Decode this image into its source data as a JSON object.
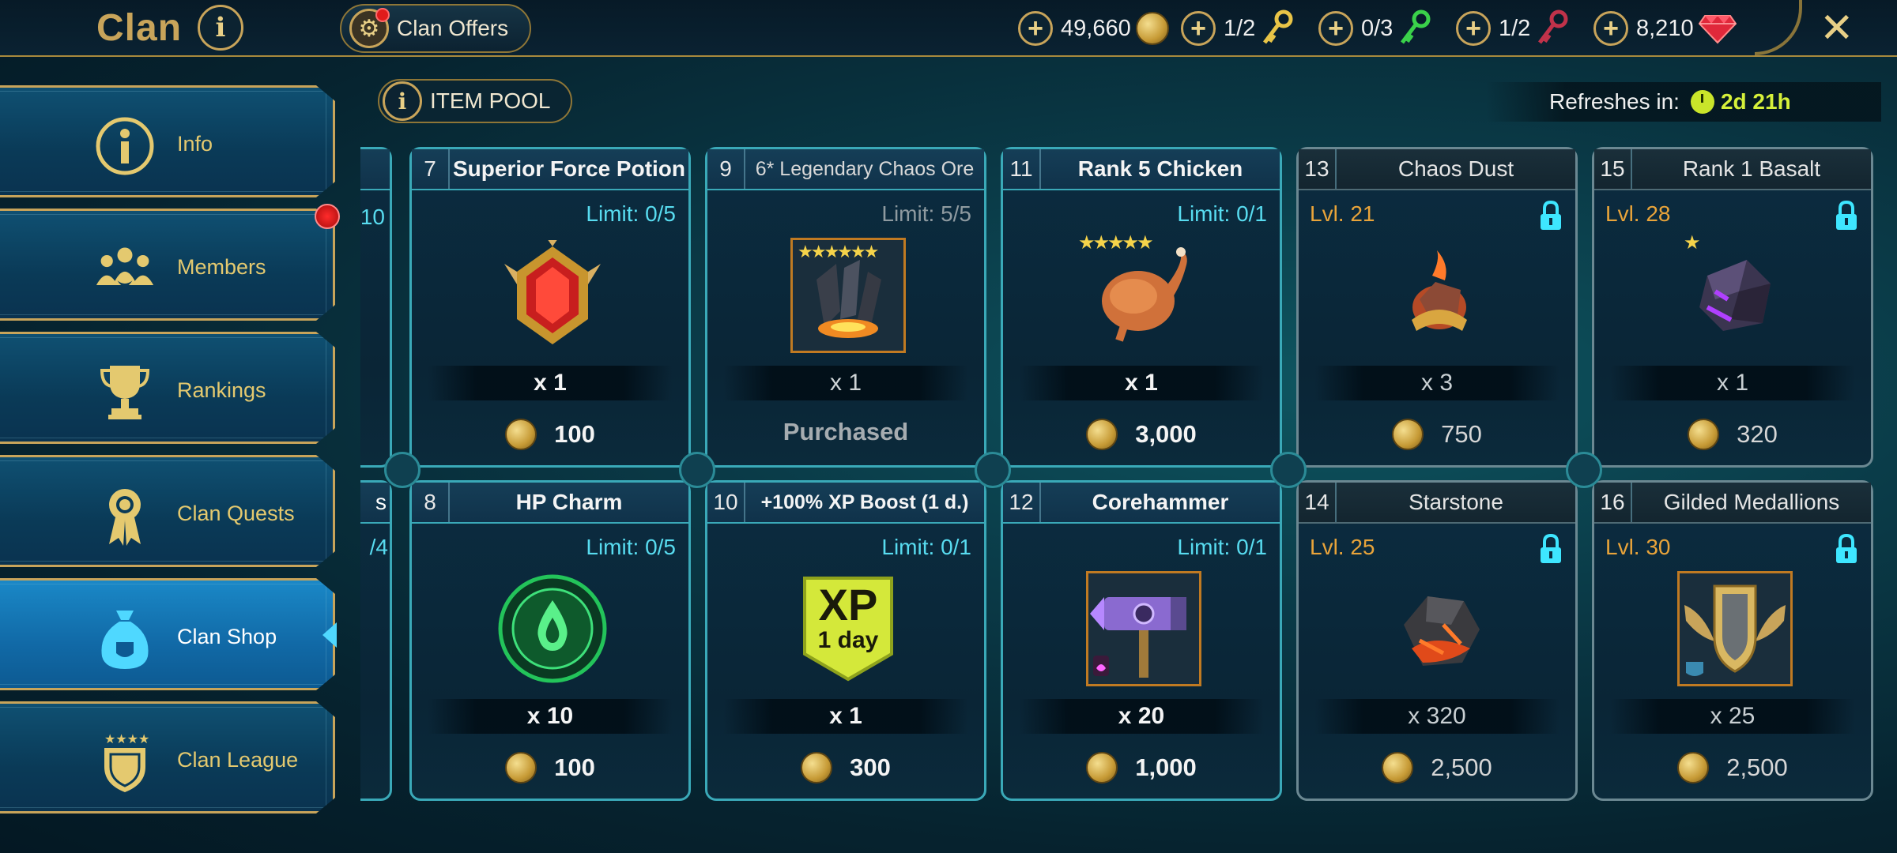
{
  "header": {
    "title": "Clan",
    "clan_offers_label": "Clan Offers",
    "currencies": [
      {
        "value": "49,660",
        "icon": "silver-coin-icon"
      },
      {
        "value": "1/2",
        "icon": "gold-key-icon"
      },
      {
        "value": "0/3",
        "icon": "green-key-icon"
      },
      {
        "value": "1/2",
        "icon": "red-key-icon"
      },
      {
        "value": "8,210",
        "icon": "gem-icon"
      }
    ]
  },
  "sidebar": {
    "items": [
      {
        "label": "Info",
        "icon": "info-icon"
      },
      {
        "label": "Members",
        "icon": "members-icon"
      },
      {
        "label": "Rankings",
        "icon": "trophy-icon"
      },
      {
        "label": "Clan Quests",
        "icon": "medal-icon"
      },
      {
        "label": "Clan Shop",
        "icon": "money-bag-icon",
        "active": true
      },
      {
        "label": "Clan League",
        "icon": "shield-icon"
      }
    ]
  },
  "shop": {
    "item_pool_label": "ITEM POOL",
    "refresh_label": "Refreshes in:",
    "refresh_time": "2d 21h",
    "partial_top": "10",
    "partial_bottom_a": "s",
    "partial_bottom_b": "/4",
    "cards": [
      {
        "num": "7",
        "name": "Superior Force Potion",
        "limit": "Limit: 0/5",
        "qty": "x 1",
        "price": "100",
        "icon": "force-potion-icon"
      },
      {
        "num": "9",
        "name": "6* Legendary Chaos Ore",
        "limit": "Limit: 5/5",
        "qty": "x 1",
        "status": "Purchased",
        "icon": "chaos-ore-icon"
      },
      {
        "num": "11",
        "name": "Rank 5 Chicken",
        "limit": "Limit: 0/1",
        "qty": "x 1",
        "price": "3,000",
        "icon": "chicken-icon"
      },
      {
        "num": "13",
        "name": "Chaos Dust",
        "level": "Lvl. 21",
        "qty": "x 3",
        "price": "750",
        "icon": "chaos-dust-icon",
        "locked": true
      },
      {
        "num": "15",
        "name": "Rank 1 Basalt",
        "level": "Lvl. 28",
        "qty": "x 1",
        "price": "320",
        "icon": "basalt-icon",
        "locked": true
      },
      {
        "num": "8",
        "name": "HP Charm",
        "limit": "Limit: 0/5",
        "qty": "x 10",
        "price": "100",
        "icon": "hp-charm-icon"
      },
      {
        "num": "10",
        "name": "+100% XP Boost (1 d.)",
        "limit": "Limit: 0/1",
        "qty": "x 1",
        "price": "300",
        "icon": "xp-boost-icon",
        "xp_big": "XP",
        "xp_small": "1 day"
      },
      {
        "num": "12",
        "name": "Corehammer",
        "limit": "Limit: 0/1",
        "qty": "x 20",
        "price": "1,000",
        "icon": "corehammer-icon"
      },
      {
        "num": "14",
        "name": "Starstone",
        "level": "Lvl. 25",
        "qty": "x 320",
        "price": "2,500",
        "icon": "starstone-icon",
        "locked": true
      },
      {
        "num": "16",
        "name": "Gilded Medallions",
        "level": "Lvl. 30",
        "qty": "x 25",
        "price": "2,500",
        "icon": "gilded-medallion-icon",
        "locked": true
      }
    ]
  },
  "colors": {
    "gold": "#c8a45a",
    "card_border": "#3aa9b8",
    "limit_text": "#58dcf0",
    "level_text": "#e9a43a",
    "timer_text": "#d6f03a"
  }
}
